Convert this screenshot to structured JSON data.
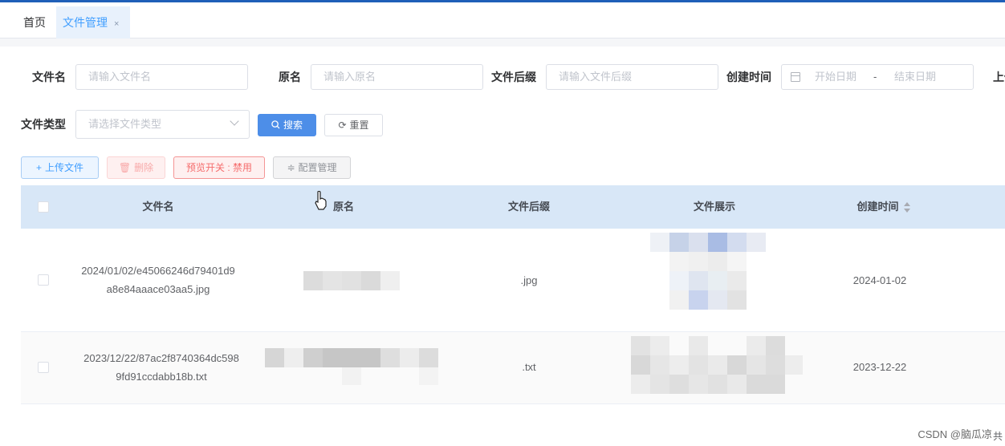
{
  "tabs": [
    {
      "label": "首页"
    },
    {
      "label": "文件管理",
      "close": "×"
    }
  ],
  "search": {
    "filename_label": "文件名",
    "filename_placeholder": "请输入文件名",
    "origname_label": "原名",
    "origname_placeholder": "请输入原名",
    "suffix_label": "文件后缀",
    "suffix_placeholder": "请输入文件后缀",
    "created_label": "创建时间",
    "start_placeholder": "开始日期",
    "range_sep": "-",
    "end_placeholder": "结束日期",
    "uploader_label_partial": "上传",
    "type_label": "文件类型",
    "type_placeholder": "请选择文件类型",
    "search_button": "搜索",
    "reset_button": "重置"
  },
  "toolbar": {
    "upload": "上传文件",
    "delete": "删除",
    "preview_toggle": "预览开关 : 禁用",
    "config": "配置管理"
  },
  "table": {
    "columns": [
      "文件名",
      "原名",
      "文件后缀",
      "文件展示",
      "创建时间"
    ],
    "rows": [
      {
        "filename_line1": "2024/01/02/e45066246d79401d9",
        "filename_line2": "a8e84aaace03aa5.jpg",
        "suffix": ".jpg",
        "created": "2024-01-02"
      },
      {
        "filename_line1": "2023/12/22/87ac2f8740364dc598",
        "filename_line2": "9fd91ccdabb18b.txt",
        "suffix": ".txt",
        "created": "2023-12-22"
      }
    ]
  },
  "watermark": "CSDN @脑瓜凉",
  "edge_text": "共",
  "colors": {
    "primary": "#4d8ee8",
    "header_bg": "#d8e7f7",
    "topbar": "#1f5fb8",
    "danger": "#f56c6c"
  }
}
